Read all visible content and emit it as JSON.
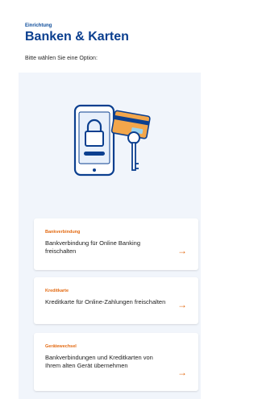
{
  "header": {
    "breadcrumb": "Einrichtung",
    "title": "Banken & Karten",
    "subtitle": "Bitte wählen Sie eine Option:"
  },
  "illustration": {
    "icon": "phone-with-lock-and-card-with-key-illustration",
    "colors": {
      "outline": "#0b3f8f",
      "accent": "#f2a64b",
      "screen": "#e8f0fb"
    }
  },
  "options": [
    {
      "title": "Bankverbindung",
      "description": "Bankverbindung für Online Banking freischalten",
      "arrow_icon": "arrow-right-icon"
    },
    {
      "title": "Kreditkarte",
      "description": "Kreditkarte für Online-Zahlungen freischalten",
      "arrow_icon": "arrow-right-icon"
    },
    {
      "title": "Gerätewechsel",
      "description": "Bankverbindungen und Kreditkarten von Ihrem alten Gerät übernehmen",
      "arrow_icon": "arrow-right-icon"
    }
  ],
  "colors": {
    "brand": "#0b3f8f",
    "accent": "#e36a12",
    "panel_background": "#f1f5fb"
  }
}
